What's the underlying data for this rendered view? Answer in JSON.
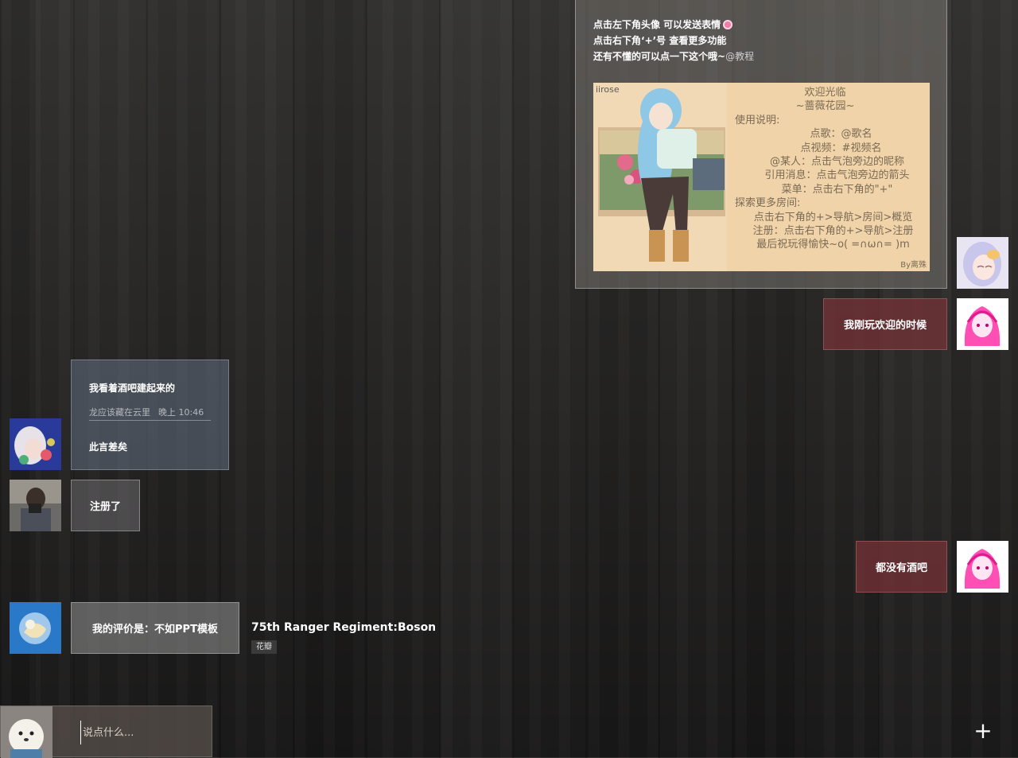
{
  "announcement": {
    "line1": "点击左下角头像  可以发送表情",
    "line2": "点击右下角‘+’号  查看更多功能",
    "line3_text": "还有不懂的可以点一下这个哦~",
    "line3_mention": "@教程",
    "poster": {
      "brand": "iirose",
      "title": "欢迎光临",
      "subtitle": "~蔷薇花园~",
      "lines": [
        "使用说明:",
        "点歌：@歌名",
        "点视频：#视频名",
        "@某人：点击气泡旁边的昵称",
        "引用消息：点击气泡旁边的箭头",
        "菜单：点击右下角的\"+\"",
        "探索更多房间:",
        "点击右下角的+>导航>房间>概览",
        "注册：点击右下角的+>导航>注册",
        "最后祝玩得愉快~o( =∩ω∩= )m"
      ],
      "credit": "By离殊"
    }
  },
  "messages": {
    "m1": "我刚玩欢迎的时候",
    "reply": {
      "quote": "我看着酒吧建起来的",
      "meta_name": "龙应该藏在云里",
      "meta_time": "晚上 10:46",
      "text": "此言差矣"
    },
    "m3": "注册了",
    "m4": "都没有酒吧",
    "m5": "我的评价是：不如PPT模板"
  },
  "sender": {
    "name": "75th Ranger Regiment:Boson",
    "tag": "花瓣"
  },
  "input": {
    "placeholder": "说点什么..."
  },
  "menu": {
    "plus_label": "+"
  }
}
